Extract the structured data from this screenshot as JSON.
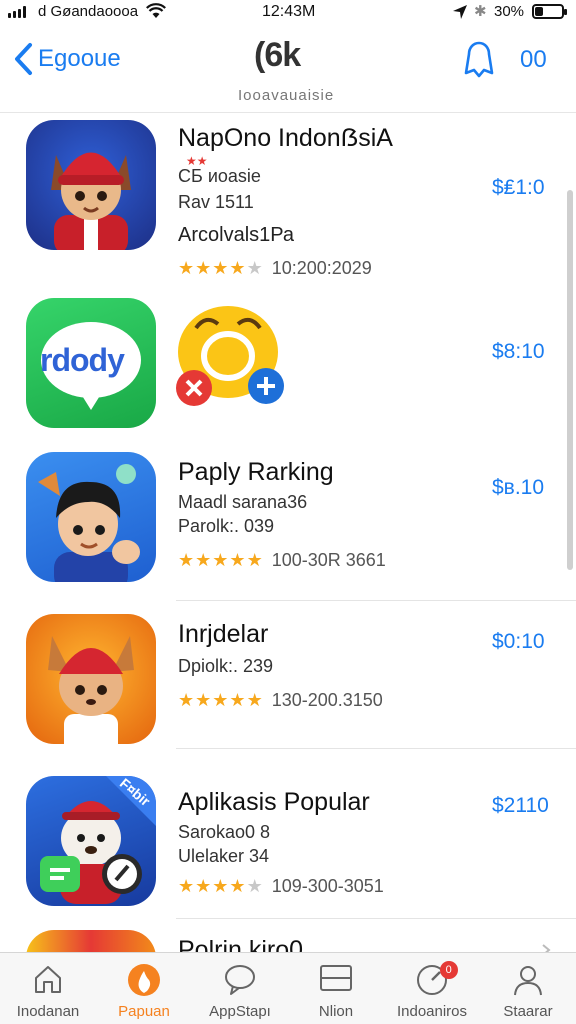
{
  "status_bar": {
    "carrier": "d Gøandaoooa",
    "time": "12:43M",
    "battery_percent": "30%",
    "battery_level": 0.3
  },
  "nav": {
    "back_label": "Egooue",
    "logo_text": "(6k",
    "subtitle": "Iooavauaisie",
    "right_label": "00"
  },
  "apps": [
    {
      "title": "NapOno  IndonẞsiA",
      "subtitle": "СБ иoasie",
      "info": "Rav 1511",
      "developer": "Arcolvals1Ра",
      "rating": 4,
      "reviews": "10:200:2029",
      "price": "$₤1:0",
      "icon": "fox-red-hat-icon"
    },
    {
      "title": "",
      "icon_text": "rdody",
      "price": "$8:10",
      "icon": "chat-bubble-icon"
    },
    {
      "title": "Paply Rarking",
      "subtitle": "Maadl sarana36",
      "info": "Parolk:. 039",
      "rating": 4.5,
      "reviews": "100-30R 3661",
      "price": "$в.10",
      "icon": "boy-avatar-icon"
    },
    {
      "title": "Inrjdelar",
      "subtitle": "Dpiolk:. 239",
      "rating": 4.5,
      "reviews": "130-200.3150",
      "price": "$0:10",
      "icon": "fox-orange-icon"
    },
    {
      "title": "Aplikasis Popular",
      "subtitle": "Sarokao0 8",
      "info": "Ulelaker 34",
      "rating": 4,
      "reviews": "109-300-3051",
      "price": "$2110",
      "icon": "bear-app-icon",
      "corner_text": "F¤bir"
    },
    {
      "title": "Polrin  kiro0",
      "icon": "partial-app-icon"
    }
  ],
  "tabs": [
    {
      "label": "Inodanan",
      "icon": "home-icon"
    },
    {
      "label": "Papuan",
      "icon": "flame-icon",
      "active": true
    },
    {
      "label": "AppStapı",
      "icon": "chat-icon"
    },
    {
      "label": "Nlion",
      "icon": "window-icon"
    },
    {
      "label": "Indoaniros",
      "icon": "gauge-icon",
      "badge": "0"
    },
    {
      "label": "Staarar",
      "icon": "person-icon"
    }
  ],
  "colors": {
    "accent": "#1a7cf0",
    "active_tab": "#f58220",
    "star": "#f7a81d",
    "badge": "#e53935"
  }
}
